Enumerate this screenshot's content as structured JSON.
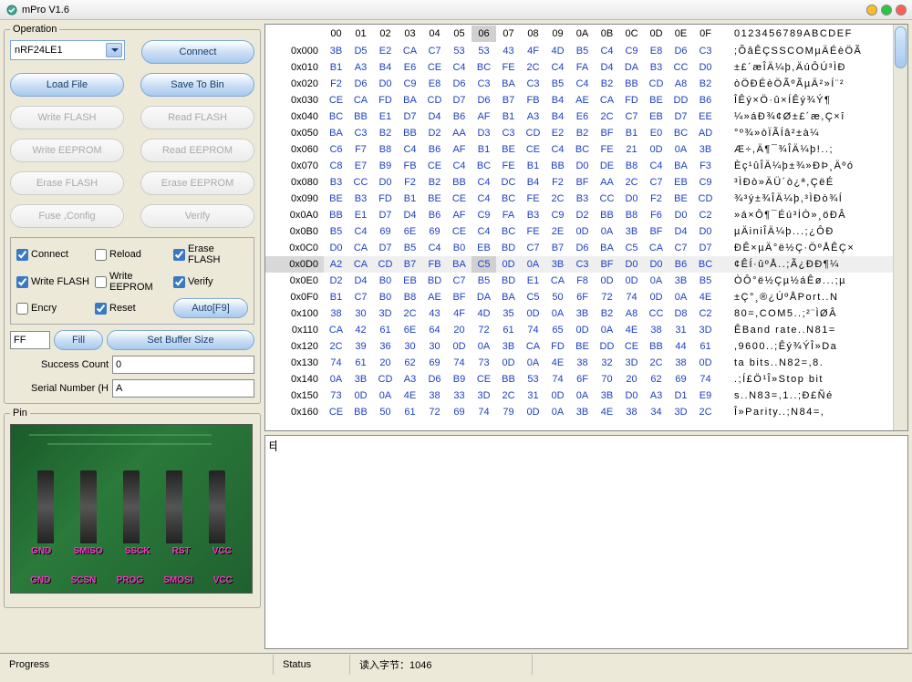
{
  "window": {
    "title": "mPro  V1.6"
  },
  "operation": {
    "legend": "Operation",
    "device": "nRF24LE1",
    "connect": "Connect",
    "loadfile": "Load File",
    "savetobin": "Save To Bin",
    "writeflash": "Write FLASH",
    "readflash": "Read FLASH",
    "writeeeprom": "Write EEPROM",
    "readeeprom": "Read EEPROM",
    "eraseflash": "Erase FLASH",
    "eraseeeprom": "Erase EEPROM",
    "fuseconfig": "Fuse ,Config",
    "verify": "Verify"
  },
  "checks": {
    "connect": "Connect",
    "reload": "Reload",
    "eraseflash": "Erase FLASH",
    "writeflash": "Write FLASH",
    "writeeeprom": "Write EEPROM",
    "verify": "Verify",
    "encry": "Encry",
    "reset": "Reset",
    "auto": "Auto[F9]"
  },
  "fill": {
    "value": "FF",
    "fill": "Fill",
    "setbuf": "Set Buffer Size"
  },
  "success": {
    "label": "Success Count",
    "value": "0"
  },
  "serial": {
    "label": "Serial Number (H",
    "value": "A"
  },
  "pin": {
    "legend": "Pin",
    "row1": [
      "GND",
      "SMISO",
      "SSCK",
      "RST",
      "VCC"
    ],
    "row2": [
      "GND",
      "SCSN",
      "PROG",
      "SMOSI",
      "VCC"
    ]
  },
  "hex": {
    "cols": [
      "00",
      "01",
      "02",
      "03",
      "04",
      "05",
      "06",
      "07",
      "08",
      "09",
      "0A",
      "0B",
      "0C",
      "0D",
      "0E",
      "0F"
    ],
    "asciihdr": "0123456789ABCDEF",
    "rows": [
      {
        "a": "0x000",
        "b": [
          "3B",
          "D5",
          "E2",
          "CA",
          "C7",
          "53",
          "53",
          "43",
          "4F",
          "4D",
          "B5",
          "C4",
          "C9",
          "E8",
          "D6",
          "C3"
        ],
        "s": ";ÕâÊÇSSCOMµÄÉèÖÃ"
      },
      {
        "a": "0x010",
        "b": [
          "B1",
          "A3",
          "B4",
          "E6",
          "CE",
          "C4",
          "BC",
          "FE",
          "2C",
          "C4",
          "FA",
          "D4",
          "DA",
          "B3",
          "CC",
          "D0"
        ],
        "s": "±£´æÎÄ¼þ,ÄúÔÚ³ÌÐ"
      },
      {
        "a": "0x020",
        "b": [
          "F2",
          "D6",
          "D0",
          "C9",
          "E8",
          "D6",
          "C3",
          "BA",
          "C3",
          "B5",
          "C4",
          "B2",
          "BB",
          "CD",
          "A8",
          "B2"
        ],
        "s": "òÖÐÉèÖÃºÃµÄ²»Í¨²"
      },
      {
        "a": "0x030",
        "b": [
          "CE",
          "CA",
          "FD",
          "BA",
          "CD",
          "D7",
          "D6",
          "B7",
          "FB",
          "B4",
          "AE",
          "CA",
          "FD",
          "BE",
          "DD",
          "B6"
        ],
        "s": "ÎÊý×Ö·û×ÍÊý¾Ý¶"
      },
      {
        "a": "0x040",
        "b": [
          "BC",
          "BB",
          "E1",
          "D7",
          "D4",
          "B6",
          "AF",
          "B1",
          "A3",
          "B4",
          "E6",
          "2C",
          "C7",
          "EB",
          "D7",
          "EE"
        ],
        "s": "¼»áÐ¾¢Ø±£´æ,Ç×î"
      },
      {
        "a": "0x050",
        "b": [
          "BA",
          "C3",
          "B2",
          "BB",
          "D2",
          "AA",
          "D3",
          "C3",
          "CD",
          "E2",
          "B2",
          "BF",
          "B1",
          "E0",
          "BC",
          "AD"
        ],
        "s": "°º¾»òÏÃÍâ²±à¼­"
      },
      {
        "a": "0x060",
        "b": [
          "C6",
          "F7",
          "B8",
          "C4",
          "B6",
          "AF",
          "B1",
          "BE",
          "CE",
          "C4",
          "BC",
          "FE",
          "21",
          "0D",
          "0A",
          "3B"
        ],
        "s": "Æ÷,Ä¶¯¾ÎÄ¼þ!..;"
      },
      {
        "a": "0x070",
        "b": [
          "C8",
          "E7",
          "B9",
          "FB",
          "CE",
          "C4",
          "BC",
          "FE",
          "B1",
          "BB",
          "D0",
          "DE",
          "B8",
          "C4",
          "BA",
          "F3"
        ],
        "s": "Èç¹ûÎÄ¼þ±¾»ÐÞ¸Äºó"
      },
      {
        "a": "0x080",
        "b": [
          "B3",
          "CC",
          "D0",
          "F2",
          "B2",
          "BB",
          "C4",
          "DC",
          "B4",
          "F2",
          "BF",
          "AA",
          "2C",
          "C7",
          "EB",
          "C9"
        ],
        "s": "³ÌÐò»ÄÜ´ò¿ª,ÇëÉ"
      },
      {
        "a": "0x090",
        "b": [
          "BE",
          "B3",
          "FD",
          "B1",
          "BE",
          "CE",
          "C4",
          "BC",
          "FE",
          "2C",
          "B3",
          "CC",
          "D0",
          "F2",
          "BE",
          "CD"
        ],
        "s": "¾³ý±¾ÎÄ¼þ,³ÌÐò¾Í"
      },
      {
        "a": "0x0A0",
        "b": [
          "BB",
          "E1",
          "D7",
          "D4",
          "B6",
          "AF",
          "C9",
          "FA",
          "B3",
          "C9",
          "D2",
          "BB",
          "B8",
          "F6",
          "D0",
          "C2"
        ],
        "s": "»á×Ô¶¯Éú³İÒ»¸öÐÂ"
      },
      {
        "a": "0x0B0",
        "b": [
          "B5",
          "C4",
          "69",
          "6E",
          "69",
          "CE",
          "C4",
          "BC",
          "FE",
          "2E",
          "0D",
          "0A",
          "3B",
          "BF",
          "D4",
          "D0"
        ],
        "s": "µÄiniÎÄ¼þ...;¿ÔÐ"
      },
      {
        "a": "0x0C0",
        "b": [
          "D0",
          "CA",
          "D7",
          "B5",
          "C4",
          "B0",
          "EB",
          "BD",
          "C7",
          "B7",
          "D6",
          "BA",
          "C5",
          "CA",
          "C7",
          "D7"
        ],
        "s": "ÐÊ×µÄ°ë½Ç·ÖºÅÊÇ×"
      },
      {
        "a": "0x0D0",
        "b": [
          "A2",
          "CA",
          "CD",
          "B7",
          "FB",
          "BA",
          "C5",
          "0D",
          "0A",
          "3B",
          "C3",
          "BF",
          "D0",
          "D0",
          "B6",
          "BC"
        ],
        "s": "¢ÊÍ·ûºÅ..;Ã¿ÐÐ¶¼"
      },
      {
        "a": "0x0E0",
        "b": [
          "D2",
          "D4",
          "B0",
          "EB",
          "BD",
          "C7",
          "B5",
          "BD",
          "E1",
          "CA",
          "F8",
          "0D",
          "0D",
          "0A",
          "3B",
          "B5"
        ],
        "s": "ÒÔ°ë½Çµ½áÊø...;µ"
      },
      {
        "a": "0x0F0",
        "b": [
          "B1",
          "C7",
          "B0",
          "B8",
          "AE",
          "BF",
          "DA",
          "BA",
          "C5",
          "50",
          "6F",
          "72",
          "74",
          "0D",
          "0A",
          "4E"
        ],
        "s": "±Ç°¸®¿ÚºÅPort..N"
      },
      {
        "a": "0x100",
        "b": [
          "38",
          "30",
          "3D",
          "2C",
          "43",
          "4F",
          "4D",
          "35",
          "0D",
          "0A",
          "3B",
          "B2",
          "A8",
          "CC",
          "D8",
          "C2"
        ],
        "s": "80=,COM5..;²¨ÌØÂ"
      },
      {
        "a": "0x110",
        "b": [
          "CA",
          "42",
          "61",
          "6E",
          "64",
          "20",
          "72",
          "61",
          "74",
          "65",
          "0D",
          "0A",
          "4E",
          "38",
          "31",
          "3D"
        ],
        "s": "ÊBand rate..N81="
      },
      {
        "a": "0x120",
        "b": [
          "2C",
          "39",
          "36",
          "30",
          "30",
          "0D",
          "0A",
          "3B",
          "CA",
          "FD",
          "BE",
          "DD",
          "CE",
          "BB",
          "44",
          "61"
        ],
        "s": ",9600..;Êý¾ÝÎ»Da"
      },
      {
        "a": "0x130",
        "b": [
          "74",
          "61",
          "20",
          "62",
          "69",
          "74",
          "73",
          "0D",
          "0A",
          "4E",
          "38",
          "32",
          "3D",
          "2C",
          "38",
          "0D"
        ],
        "s": "ta bits..N82=,8."
      },
      {
        "a": "0x140",
        "b": [
          "0A",
          "3B",
          "CD",
          "A3",
          "D6",
          "B9",
          "CE",
          "BB",
          "53",
          "74",
          "6F",
          "70",
          "20",
          "62",
          "69",
          "74"
        ],
        "s": ".;Í£Ö¹Î»Stop bit"
      },
      {
        "a": "0x150",
        "b": [
          "73",
          "0D",
          "0A",
          "4E",
          "38",
          "33",
          "3D",
          "2C",
          "31",
          "0D",
          "0A",
          "3B",
          "D0",
          "A3",
          "D1",
          "E9"
        ],
        "s": "s..N83=,1..;Ð£Ñé"
      },
      {
        "a": "0x160",
        "b": [
          "CE",
          "BB",
          "50",
          "61",
          "72",
          "69",
          "74",
          "79",
          "0D",
          "0A",
          "3B",
          "4E",
          "38",
          "34",
          "3D",
          "2C"
        ],
        "s": "Î»Parity..;N84=,"
      }
    ],
    "selrow": 13,
    "hlcol": 6
  },
  "log": {
    "text": "E"
  },
  "status": {
    "progress": "Progress",
    "status": "Status",
    "info": "读入字节：1046"
  }
}
